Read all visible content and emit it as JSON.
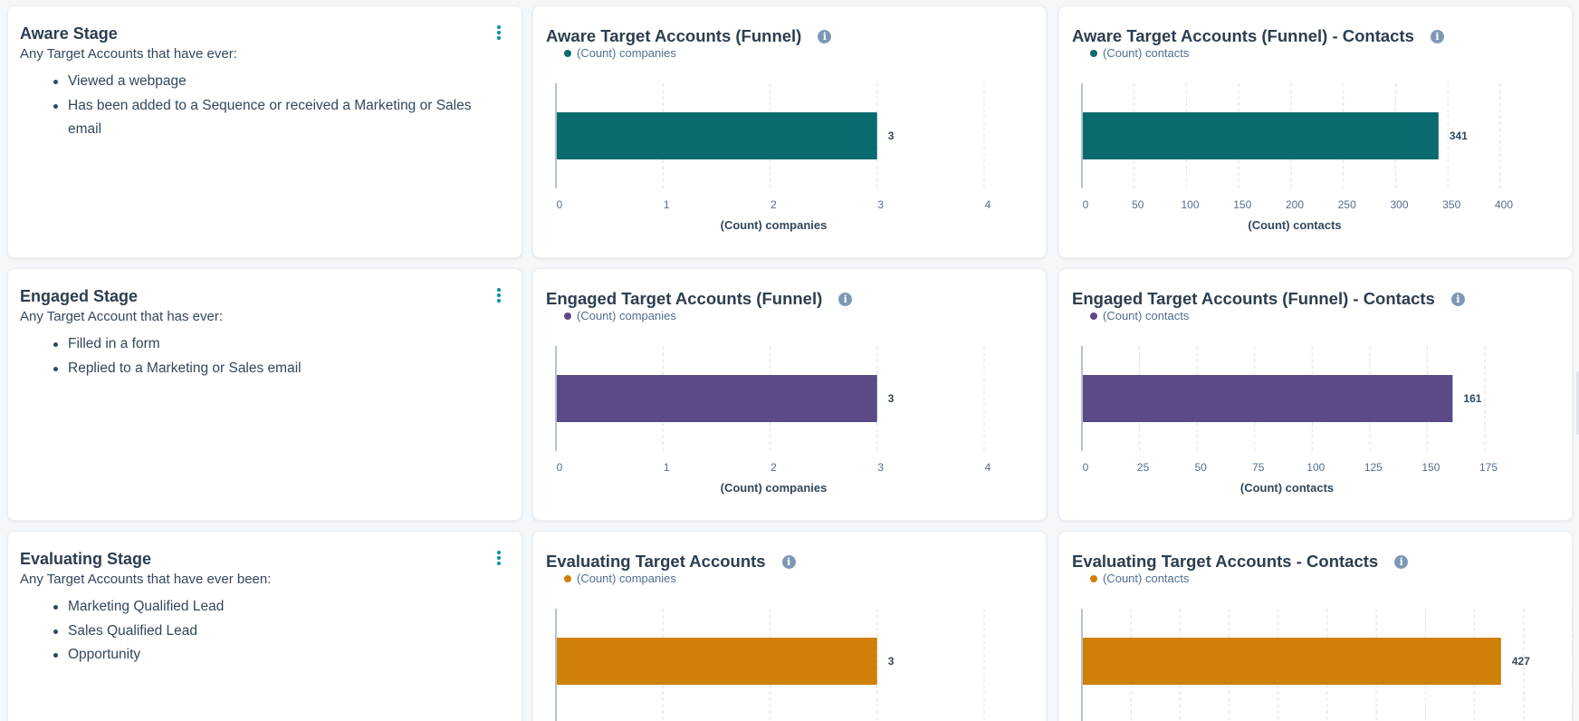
{
  "stages": [
    {
      "title": "Aware Stage",
      "description": "Any Target Accounts that have ever:",
      "items": [
        "Viewed a webpage",
        "Has been added to a Sequence or received a Marketing or Sales email"
      ]
    },
    {
      "title": "Engaged Stage",
      "description": "Any Target Account that has ever:",
      "items": [
        "Filled in a form",
        "Replied to a Marketing or Sales email"
      ]
    },
    {
      "title": "Evaluating Stage",
      "description": "Any Target Accounts that have ever been:",
      "items": [
        "Marketing Qualified Lead",
        "Sales Qualified Lead",
        "Opportunity"
      ]
    }
  ],
  "colors": {
    "aware": "#0b6a6e",
    "engaged": "#5b4a85",
    "evaluating": "#ce8008",
    "menu_icon": "#0091ae",
    "info_icon": "#7c98b6"
  },
  "icons": {
    "menu": "vertical-dots-icon",
    "info": "info-circle-icon"
  },
  "chart_data": [
    {
      "type": "bar",
      "orientation": "horizontal",
      "title": "Aware Target Accounts (Funnel)",
      "series": [
        {
          "name": "(Count) companies",
          "values": [
            3
          ]
        }
      ],
      "xlabel": "(Count) companies",
      "xlim": [
        0,
        4
      ],
      "ticks": [
        "0",
        "1",
        "2",
        "3",
        "4"
      ],
      "data_labels": [
        "3"
      ],
      "color": "#0b6a6e",
      "grid": true,
      "legend": "top-left"
    },
    {
      "type": "bar",
      "orientation": "horizontal",
      "title": "Aware Target Accounts (Funnel) - Contacts",
      "series": [
        {
          "name": "(Count) contacts",
          "values": [
            341
          ]
        }
      ],
      "xlabel": "(Count) contacts",
      "xlim": [
        0,
        400
      ],
      "ticks": [
        "0",
        "50",
        "100",
        "150",
        "200",
        "250",
        "300",
        "350",
        "400"
      ],
      "data_labels": [
        "341"
      ],
      "color": "#0b6a6e",
      "grid": true,
      "legend": "top-left"
    },
    {
      "type": "bar",
      "orientation": "horizontal",
      "title": "Engaged Target Accounts (Funnel)",
      "series": [
        {
          "name": "(Count) companies",
          "values": [
            3
          ]
        }
      ],
      "xlabel": "(Count) companies",
      "xlim": [
        0,
        4
      ],
      "ticks": [
        "0",
        "1",
        "2",
        "3",
        "4"
      ],
      "data_labels": [
        "3"
      ],
      "color": "#5b4a85",
      "grid": true,
      "legend": "top-left"
    },
    {
      "type": "bar",
      "orientation": "horizontal",
      "title": "Engaged Target Accounts (Funnel) - Contacts",
      "series": [
        {
          "name": "(Count) contacts",
          "values": [
            161
          ]
        }
      ],
      "xlabel": "(Count) contacts",
      "xlim": [
        0,
        175
      ],
      "ticks": [
        "0",
        "25",
        "50",
        "75",
        "100",
        "125",
        "150",
        "175"
      ],
      "data_labels": [
        "161"
      ],
      "color": "#5b4a85",
      "grid": true,
      "legend": "top-left"
    },
    {
      "type": "bar",
      "orientation": "horizontal",
      "title": "Evaluating Target Accounts",
      "series": [
        {
          "name": "(Count) companies",
          "values": [
            3
          ]
        }
      ],
      "xlabel": "",
      "xlim": [
        0,
        4
      ],
      "ticks": [],
      "data_labels": [
        "3"
      ],
      "color": "#ce8008",
      "grid": true,
      "legend": "top-left"
    },
    {
      "type": "bar",
      "orientation": "horizontal",
      "title": "Evaluating Target Accounts - Contacts",
      "series": [
        {
          "name": "(Count) contacts",
          "values": [
            427
          ]
        }
      ],
      "xlabel": "",
      "xlim": [
        0,
        500
      ],
      "ticks": [],
      "data_labels": [
        "427"
      ],
      "color": "#ce8008",
      "grid": true,
      "legend": "top-left"
    }
  ]
}
